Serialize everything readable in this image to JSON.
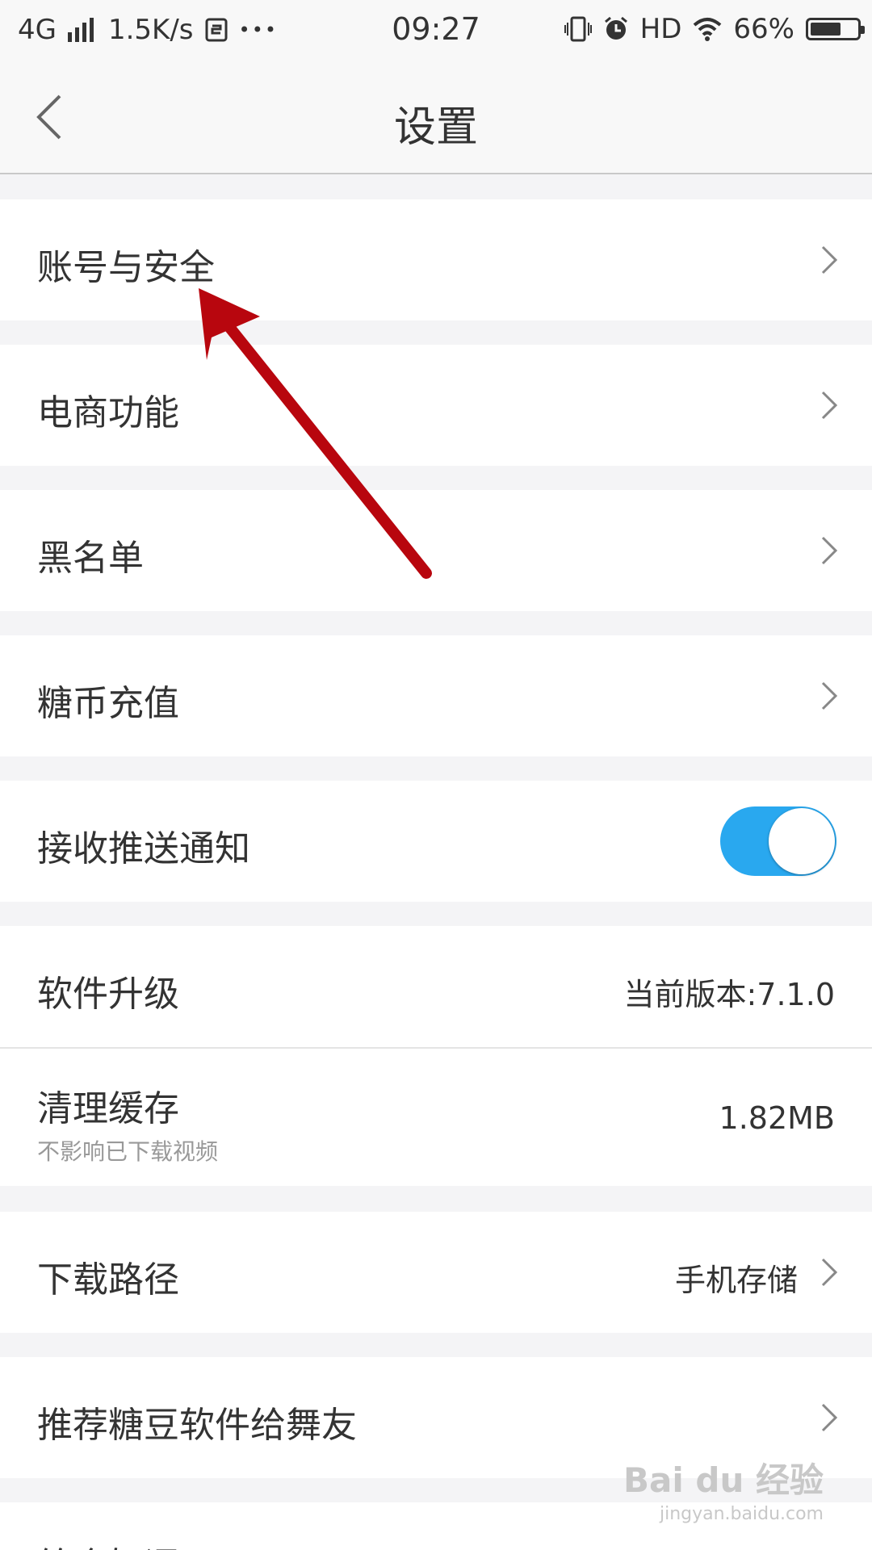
{
  "status_bar": {
    "network": "4G",
    "speed": "1.5K/s",
    "more": "•••",
    "time": "09:27",
    "hd": "HD",
    "battery": "66%",
    "battery_level": 0.66
  },
  "header": {
    "title": "设置"
  },
  "settings": {
    "account_security": "账号与安全",
    "ecommerce": "电商功能",
    "blacklist": "黑名单",
    "recharge": "糖币充值",
    "push": {
      "label": "接收推送通知",
      "enabled": true
    },
    "upgrade": {
      "label": "软件升级",
      "value": "当前版本:7.1.0"
    },
    "cache": {
      "label": "清理缓存",
      "sub": "不影响已下载视频",
      "value": "1.82MB"
    },
    "download_path": {
      "label": "下载路径",
      "value": "手机存储"
    },
    "recommend": "推荐糖豆软件给舞友",
    "next_partial": "给个好评"
  },
  "watermark": {
    "main": "Bai du 经验",
    "sub": "jingyan.baidu.com"
  },
  "colors": {
    "toggle_on": "#29a8ef",
    "annotation_arrow": "#b8060e",
    "page_bg": "#f4f4f6"
  }
}
